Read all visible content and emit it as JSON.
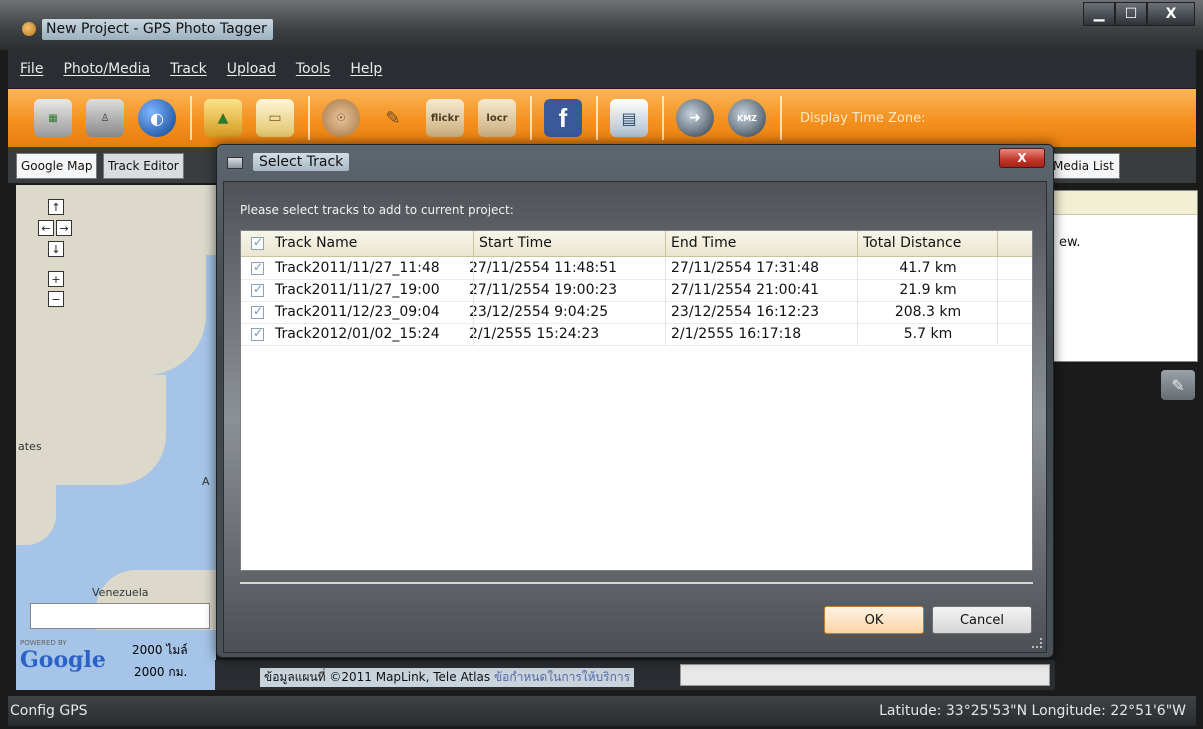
{
  "window": {
    "title": "New Project - GPS Photo Tagger",
    "buttons": {
      "minimize": "▁",
      "maximize": "☐",
      "close": "X"
    }
  },
  "menu": [
    "File",
    "Photo/Media",
    "Track",
    "Upload",
    "Tools",
    "Help"
  ],
  "toolbar": {
    "icons": [
      "layers-icon",
      "joystick-icon",
      "globe-icon",
      "folder-image-icon",
      "image-icon",
      "coin-icon",
      "rocket-icon",
      "flickr-icon",
      "locr-icon",
      "facebook-icon",
      "document-icon",
      "gps-device-icon",
      "kmz-icon"
    ],
    "flickr_label": "flickr",
    "locr_label": "locr",
    "facebook_label": "f",
    "kmz_label": "KMZ",
    "time_zone_label": "Display Time Zone:"
  },
  "tabs": {
    "google_map": "Google Map",
    "track_editor": "Track Editor",
    "media_list": "Media List"
  },
  "map": {
    "labels": {
      "states": "ates",
      "venezuela": "Venezuela",
      "a_fragment": "A"
    },
    "powered_by": "POWERED BY",
    "google_logo": "Google",
    "scale_miles": "2000 ไมล์",
    "scale_km": "2000 กม.",
    "copyright": "ข้อมูลแผนที่ ©2011 MapLink, Tele Atlas",
    "terms": "ข้อกำหนดในการให้บริการ"
  },
  "right_panel": {
    "text": "ew."
  },
  "status": {
    "left": "Config GPS",
    "coords": "Latitude: 33°25'53\"N  Longitude: 22°51'6\"W"
  },
  "dialog": {
    "title": "Select Track",
    "prompt": "Please select tracks to add to current project:",
    "columns": [
      "Track Name",
      "Start Time",
      "End Time",
      "Total Distance"
    ],
    "rows": [
      {
        "name": "Track2011/11/27_11:48",
        "start": "27/11/2554 11:48:51",
        "end": "27/11/2554 17:31:48",
        "distance": "41.7 km"
      },
      {
        "name": "Track2011/11/27_19:00",
        "start": "27/11/2554 19:00:23",
        "end": "27/11/2554 21:00:41",
        "distance": "21.9 km"
      },
      {
        "name": "Track2011/12/23_09:04",
        "start": "23/12/2554 9:04:25",
        "end": "23/12/2554 16:12:23",
        "distance": "208.3 km"
      },
      {
        "name": "Track2012/01/02_15:24",
        "start": "2/1/2555 15:24:23",
        "end": "2/1/2555 16:17:18",
        "distance": "5.7 km"
      }
    ],
    "ok": "OK",
    "cancel": "Cancel",
    "close": "X"
  },
  "colors": {
    "toolbar_orange": "#f4911e",
    "dialog_dark": "#3c4349",
    "header_beige": "#ebe6cf"
  }
}
